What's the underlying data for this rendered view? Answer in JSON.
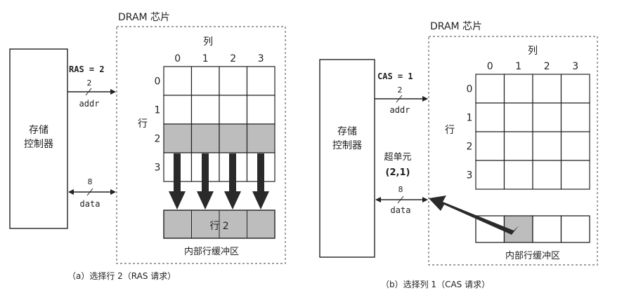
{
  "panel_a": {
    "controller_label_line1": "存储",
    "controller_label_line2": "控制器",
    "chip_title": "DRAM 芯片",
    "signal": "RAS = 2",
    "addr_width": "2",
    "addr_label": "addr",
    "data_width": "8",
    "data_label": "data",
    "col_header": "列",
    "row_header": "行",
    "col_indices": [
      "0",
      "1",
      "2",
      "3"
    ],
    "row_indices": [
      "0",
      "1",
      "2",
      "3"
    ],
    "buffer_row_label": "行 2",
    "buffer_label": "内部行缓冲区",
    "caption": "（a）选择行 2（RAS 请求）",
    "selected_row": 2
  },
  "panel_b": {
    "controller_label_line1": "存储",
    "controller_label_line2": "控制器",
    "chip_title": "DRAM 芯片",
    "signal": "CAS = 1",
    "addr_width": "2",
    "addr_label": "addr",
    "data_width": "8",
    "data_label": "data",
    "col_header": "列",
    "row_header": "行",
    "col_indices": [
      "0",
      "1",
      "2",
      "3"
    ],
    "row_indices": [
      "0",
      "1",
      "2",
      "3"
    ],
    "supercell_line1": "超单元",
    "supercell_line2": "(2,1)",
    "buffer_label": "内部行缓冲区",
    "caption": "（b）选择列 1（CAS 请求）",
    "selected_col": 1
  },
  "colors": {
    "line": "#222222",
    "shade": "#bdbdbd",
    "dashed": "#666666",
    "arrow": "#2a2a2a"
  }
}
